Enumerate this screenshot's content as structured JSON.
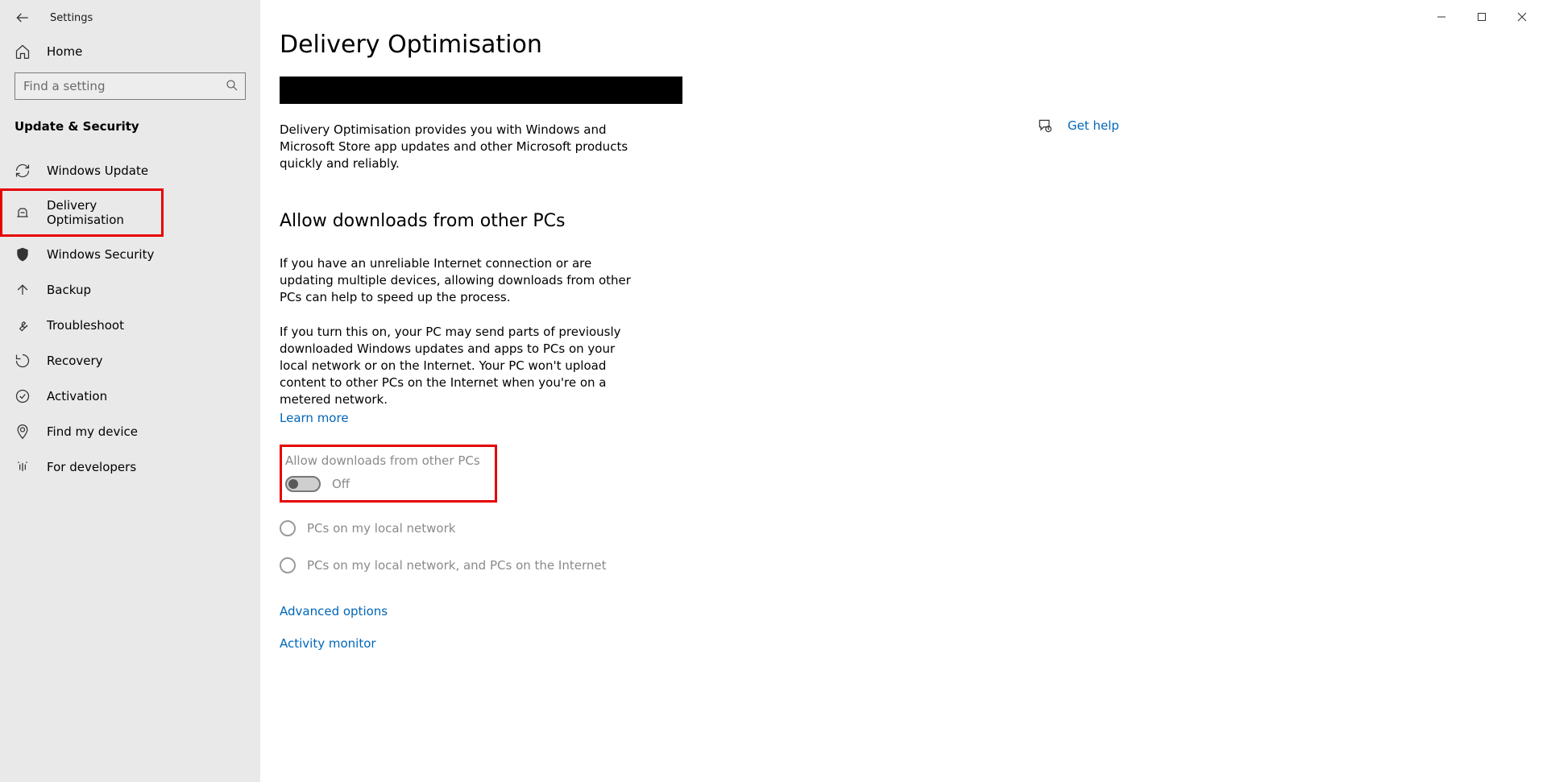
{
  "window": {
    "title": "Settings"
  },
  "sidebar": {
    "home": "Home",
    "search_placeholder": "Find a setting",
    "section": "Update & Security",
    "items": [
      {
        "label": "Windows Update"
      },
      {
        "label": "Delivery Optimisation"
      },
      {
        "label": "Windows Security"
      },
      {
        "label": "Backup"
      },
      {
        "label": "Troubleshoot"
      },
      {
        "label": "Recovery"
      },
      {
        "label": "Activation"
      },
      {
        "label": "Find my device"
      },
      {
        "label": "For developers"
      }
    ]
  },
  "main": {
    "title": "Delivery Optimisation",
    "desc": "Delivery Optimisation provides you with Windows and Microsoft Store app updates and other Microsoft products quickly and reliably.",
    "subheading": "Allow downloads from other PCs",
    "para1": "If you have an unreliable Internet connection or are updating multiple devices, allowing downloads from other PCs can help to speed up the process.",
    "para2": "If you turn this on, your PC may send parts of previously downloaded Windows updates and apps to PCs on your local network or on the Internet. Your PC won't upload content to other PCs on the Internet when you're on a metered network.",
    "learn_more": "Learn more",
    "toggle_label": "Allow downloads from other PCs",
    "toggle_state": "Off",
    "radio1": "PCs on my local network",
    "radio2": "PCs on my local network, and PCs on the Internet",
    "advanced": "Advanced options",
    "activity": "Activity monitor"
  },
  "help": {
    "label": "Get help"
  }
}
